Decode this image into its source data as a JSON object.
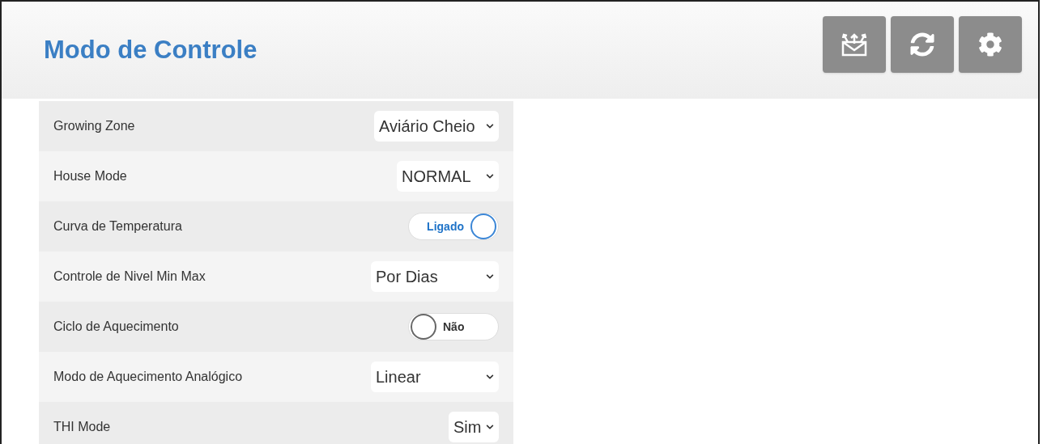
{
  "header": {
    "title": "Modo de Controle"
  },
  "rows": [
    {
      "label": "Growing Zone",
      "kind": "select",
      "value": "Aviário Cheio"
    },
    {
      "label": "House Mode",
      "kind": "select",
      "value": "NORMAL"
    },
    {
      "label": "Curva de Temperatura",
      "kind": "toggle",
      "on": true,
      "value": "Ligado"
    },
    {
      "label": "Controle de Nivel Min Max",
      "kind": "select",
      "value": "Por Dias"
    },
    {
      "label": "Ciclo de Aquecimento",
      "kind": "toggle",
      "on": false,
      "value": "Não"
    },
    {
      "label": "Modo de Aquecimento Analógico",
      "kind": "select",
      "value": "Linear"
    },
    {
      "label": "THI Mode",
      "kind": "select",
      "value": "Sim"
    }
  ]
}
